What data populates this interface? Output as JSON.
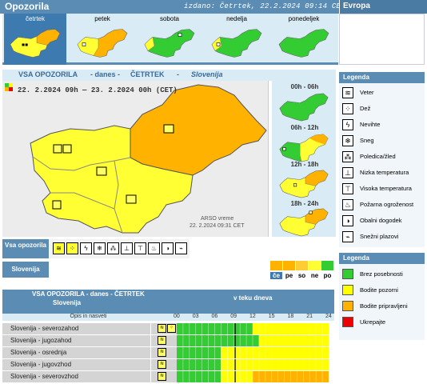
{
  "header": {
    "title": "Opozorila",
    "issued": "izdano: Četrtek, 22.2.2024 09:14 CET",
    "europe": "Evropa"
  },
  "days": [
    {
      "label": "četrtek",
      "active": true
    },
    {
      "label": "petek",
      "active": false
    },
    {
      "label": "sobota",
      "active": false
    },
    {
      "label": "nedelja",
      "active": false
    },
    {
      "label": "ponedeljek",
      "active": false
    }
  ],
  "main": {
    "t1": "VSA OPOZORILA",
    "t2": "- danes -",
    "t3": "ČETRTEK",
    "t4": "-",
    "t5": "Slovenija",
    "period": "22. 2.2024 09h  —  23. 2.2024 00h   (CET)",
    "credit1": "ARSO vreme",
    "credit2": "22. 2.2024  09:31 CET"
  },
  "slots": [
    "00h - 06h",
    "06h - 12h",
    "12h - 18h",
    "18h - 24h"
  ],
  "legend": {
    "title": "Legenda",
    "items": [
      {
        "label": "Veter",
        "icon": "wind-icon",
        "glyph": "≋"
      },
      {
        "label": "Dež",
        "icon": "rain-icon",
        "glyph": "⁘"
      },
      {
        "label": "Nevihte",
        "icon": "thunderstorm-icon",
        "glyph": "ϟ"
      },
      {
        "label": "Sneg",
        "icon": "snow-icon",
        "glyph": "❄"
      },
      {
        "label": "Poledica/žled",
        "icon": "ice-icon",
        "glyph": "⁂"
      },
      {
        "label": "Nizka temperatura",
        "icon": "low-temperature-icon",
        "glyph": "⊥"
      },
      {
        "label": "Visoka temperatura",
        "icon": "high-temperature-icon",
        "glyph": "⊤"
      },
      {
        "label": "Požarna ogroženost",
        "icon": "fire-danger-icon",
        "glyph": "♨"
      },
      {
        "label": "Obalni dogodek",
        "icon": "coastal-event-icon",
        "glyph": "◑"
      },
      {
        "label": "Snežni plazovi",
        "icon": "avalanche-icon",
        "glyph": "⌁"
      }
    ]
  },
  "levels": {
    "title": "Legenda",
    "items": [
      {
        "label": "Brez posebnosti",
        "color": "#33cc33"
      },
      {
        "label": "Bodite pozorni",
        "color": "#ffff00"
      },
      {
        "label": "Bodite pripravljeni",
        "color": "#ffb300"
      },
      {
        "label": "Ukrepajte",
        "color": "#ee0000"
      }
    ]
  },
  "strip": {
    "vsa": "Vsa opozorila",
    "slovenija": "Slovenija",
    "scale": [
      "če",
      "pe",
      "so",
      "ne",
      "po"
    ],
    "scale_colors": [
      "#ffb300",
      "#ffb300",
      "#ffcc33",
      "#ffff33",
      "#33cc33"
    ]
  },
  "table": {
    "title": "VSA OPOZORILA - danes - ČETRTEK",
    "subtitle": "Slovenija",
    "teku": "v teku dneva",
    "opis": "Opis in nasveti",
    "hours": [
      "00",
      "03",
      "06",
      "09",
      "12",
      "15",
      "18",
      "21",
      "24"
    ],
    "rows": [
      {
        "name": "Slovenija - severozahod",
        "yellow_from_hour": 12,
        "orange_from_hour": null
      },
      {
        "name": "Slovenija - jugozahod",
        "yellow_from_hour": 13,
        "orange_from_hour": null
      },
      {
        "name": "Slovenija - osrednja",
        "yellow_from_hour": 7,
        "orange_from_hour": null
      },
      {
        "name": "Slovenija - jugovzhod",
        "yellow_from_hour": 7,
        "orange_from_hour": null
      },
      {
        "name": "Slovenija - severovzhod",
        "yellow_from_hour": 7,
        "orange_from_hour": 12
      }
    ]
  }
}
